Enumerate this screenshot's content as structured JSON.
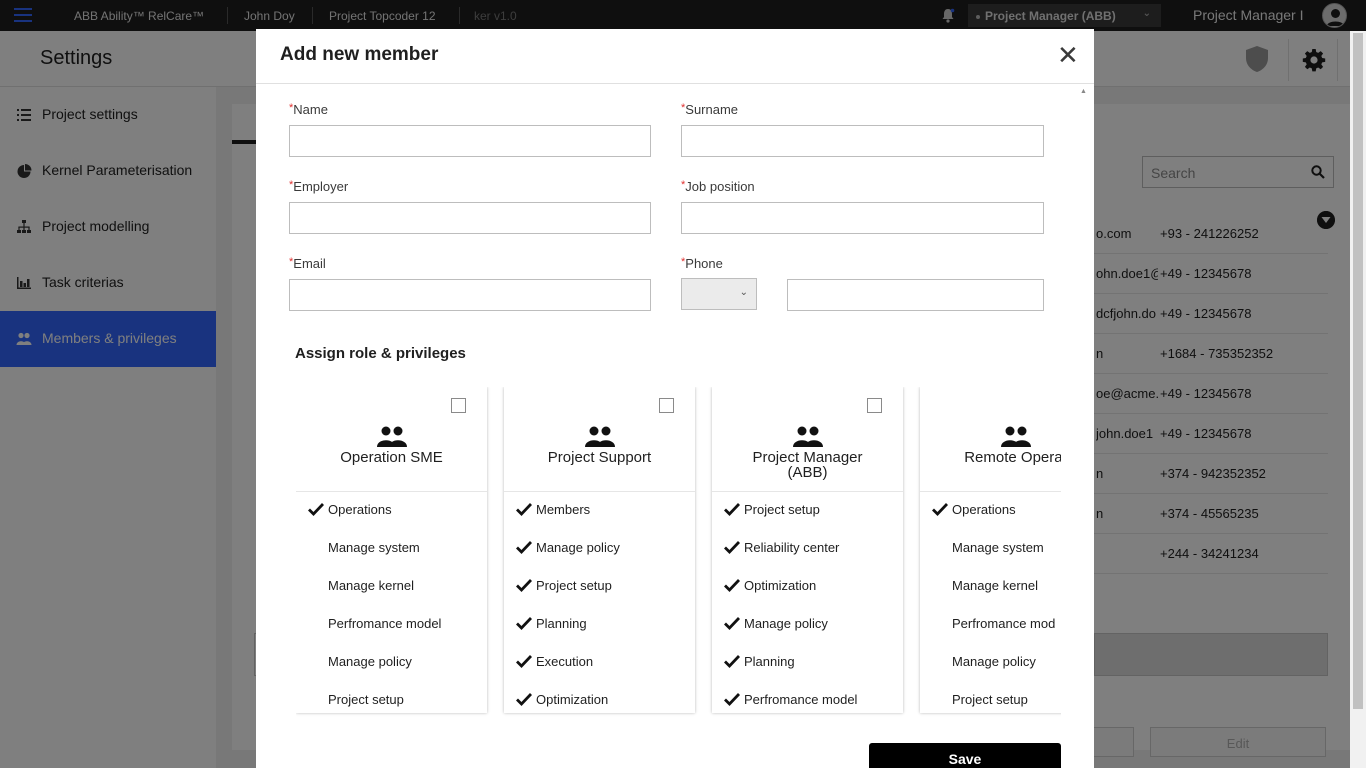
{
  "topbar": {
    "app_name": "ABB Ability™ RelCare™",
    "user": "John Doy",
    "project": "Project Topcoder 12",
    "kernel_version": "ker v1.0",
    "role_selected": "Project Manager (ABB)",
    "role_short": "Project Manager I"
  },
  "header": {
    "title": "Settings"
  },
  "sidebar": {
    "items": [
      {
        "label": "Project settings",
        "icon": "list-icon"
      },
      {
        "label": "Kernel Parameterisation",
        "icon": "pie-chart-icon"
      },
      {
        "label": "Project modelling",
        "icon": "hierarchy-icon"
      },
      {
        "label": "Task criterias",
        "icon": "bar-chart-icon"
      },
      {
        "label": "Members & privileges",
        "icon": "people-icon",
        "active": true
      }
    ]
  },
  "background": {
    "search_placeholder": "Search",
    "rows": [
      {
        "email": "o.com",
        "phone": "+93 - 241226252"
      },
      {
        "email": "ohn.doe1@",
        "phone": "+49 - 12345678"
      },
      {
        "email": "dcfjohn.do",
        "phone": "+49 - 12345678"
      },
      {
        "email": "n",
        "phone": "+1684 - 735352352"
      },
      {
        "email": "oe@acme.",
        "phone": "+49 - 12345678"
      },
      {
        "email": "john.doe1",
        "phone": "+49 - 12345678"
      },
      {
        "email": "n",
        "phone": "+374 - 942352352"
      },
      {
        "email": "n",
        "phone": "+374 - 45565235"
      },
      {
        "email": "",
        "phone": "+244 - 34241234"
      }
    ],
    "edit_label": "Edit"
  },
  "modal": {
    "title": "Add new member",
    "required_marker": "*",
    "fields": {
      "name": {
        "label": "Name",
        "value": ""
      },
      "surname": {
        "label": "Surname",
        "value": ""
      },
      "employer": {
        "label": "Employer",
        "value": ""
      },
      "job_position": {
        "label": "Job position",
        "value": ""
      },
      "email": {
        "label": "Email",
        "value": ""
      },
      "phone": {
        "label": "Phone",
        "code_value": "",
        "value": ""
      }
    },
    "section_title": "Assign role & privileges",
    "roles": [
      {
        "name": "Operation SME",
        "checked": false,
        "privileges": [
          {
            "label": "Operations",
            "granted": true
          },
          {
            "label": "Manage system",
            "granted": false
          },
          {
            "label": "Manage kernel",
            "granted": false
          },
          {
            "label": "Perfromance model",
            "granted": false
          },
          {
            "label": "Manage policy",
            "granted": false
          },
          {
            "label": "Project setup",
            "granted": false
          }
        ]
      },
      {
        "name": "Project Support",
        "checked": false,
        "privileges": [
          {
            "label": "Members",
            "granted": true
          },
          {
            "label": "Manage policy",
            "granted": true
          },
          {
            "label": "Project setup",
            "granted": true
          },
          {
            "label": "Planning",
            "granted": true
          },
          {
            "label": "Execution",
            "granted": true
          },
          {
            "label": "Optimization",
            "granted": true
          }
        ]
      },
      {
        "name": "Project Manager (ABB)",
        "checked": false,
        "privileges": [
          {
            "label": "Project setup",
            "granted": true
          },
          {
            "label": "Reliability center",
            "granted": true
          },
          {
            "label": "Optimization",
            "granted": true
          },
          {
            "label": "Manage policy",
            "granted": true
          },
          {
            "label": "Planning",
            "granted": true
          },
          {
            "label": "Perfromance model",
            "granted": true
          }
        ]
      },
      {
        "name": "Remote Operat",
        "checked": false,
        "privileges": [
          {
            "label": "Operations",
            "granted": true
          },
          {
            "label": "Manage system",
            "granted": false
          },
          {
            "label": "Manage kernel",
            "granted": false
          },
          {
            "label": "Perfromance mod",
            "granted": false
          },
          {
            "label": "Manage policy",
            "granted": false
          },
          {
            "label": "Project setup",
            "granted": false
          }
        ]
      }
    ],
    "save_label": "Save"
  },
  "colors": {
    "accent": "#3366ff",
    "topbar": "#1f1f1f",
    "required": "#e0302f",
    "save_button": "#000000"
  }
}
